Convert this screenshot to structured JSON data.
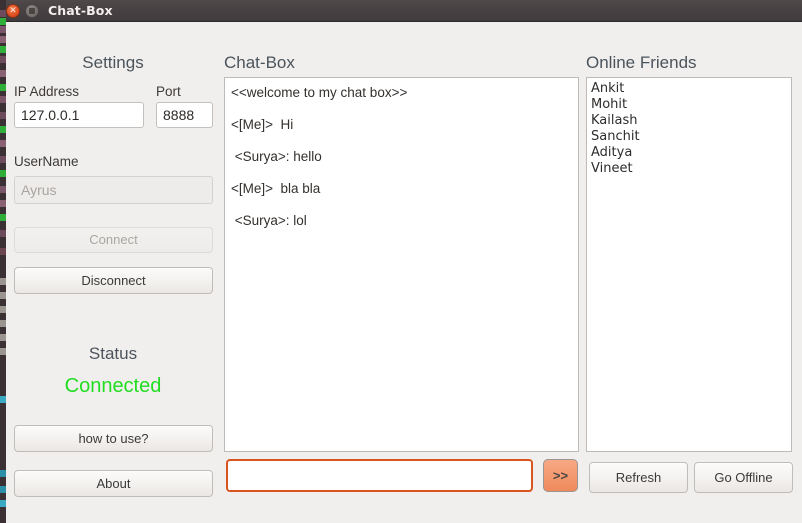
{
  "window": {
    "title": "Chat-Box",
    "close_icon": "window-close-icon",
    "maximize_icon": "window-maximize-icon"
  },
  "settings": {
    "heading": "Settings",
    "ip_label": "IP Address",
    "ip_value": "127.0.0.1",
    "port_label": "Port",
    "port_value": "8888",
    "username_label": "UserName",
    "username_value": "Ayrus",
    "connect_label": "Connect",
    "disconnect_label": "Disconnect",
    "status_label": "Status",
    "status_value": "Connected",
    "status_color": "#22dd22",
    "how_to_use_label": "how to use?",
    "about_label": "About"
  },
  "chat": {
    "heading": "Chat-Box",
    "messages": [
      "<<welcome to my chat box>>",
      "<[Me]>  Hi",
      " <Surya>: hello",
      "<[Me]>  bla bla",
      " <Surya>: lol"
    ],
    "input_value": "",
    "input_placeholder": "",
    "send_label": ">>"
  },
  "friends": {
    "heading": "Online Friends",
    "names": [
      "Ankit",
      "Mohit",
      "Kailash",
      "Sanchit",
      "Aditya",
      "Vineet"
    ],
    "refresh_label": "Refresh",
    "go_offline_label": "Go Offline"
  },
  "colors": {
    "accent_orange": "#d9551f",
    "send_button": "#f3986e",
    "status_green": "#22dd22",
    "titlebar": "#464042"
  }
}
